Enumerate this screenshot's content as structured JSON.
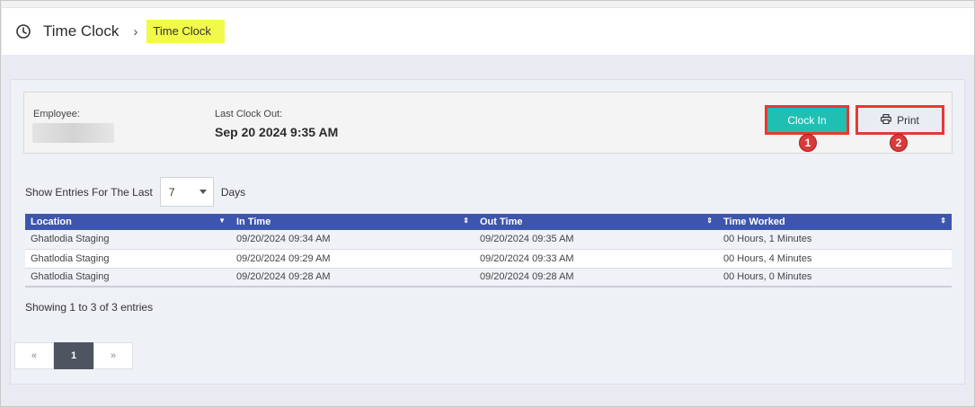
{
  "header": {
    "title": "Time Clock",
    "breadcrumb_current": "Time Clock"
  },
  "employee_panel": {
    "employee_label": "Employee:",
    "last_clock_out_label": "Last Clock Out:",
    "last_clock_out_value": "Sep 20 2024 9:35 AM",
    "clock_in_label": "Clock In",
    "print_label": "Print",
    "badge_1": "1",
    "badge_2": "2"
  },
  "filter": {
    "prefix": "Show Entries For The Last",
    "selected_days": "7",
    "suffix": "Days"
  },
  "table": {
    "columns": [
      "Location",
      "In Time",
      "Out Time",
      "Time Worked"
    ],
    "rows": [
      [
        "Ghatlodia Staging",
        "09/20/2024 09:34 AM",
        "09/20/2024 09:35 AM",
        "00 Hours, 1 Minutes"
      ],
      [
        "Ghatlodia Staging",
        "09/20/2024 09:29 AM",
        "09/20/2024 09:33 AM",
        "00 Hours, 4 Minutes"
      ],
      [
        "Ghatlodia Staging",
        "09/20/2024 09:28 AM",
        "09/20/2024 09:28 AM",
        "00 Hours, 0 Minutes"
      ]
    ]
  },
  "footer": {
    "showing_text": "Showing 1 to 3 of 3 entries"
  },
  "pagination": {
    "prev": "«",
    "current": "1",
    "next": "»"
  },
  "colors": {
    "accent_teal": "#1fbfb3",
    "table_header": "#3d55ad",
    "highlight_red": "#e53935",
    "breadcrumb_highlight": "#f1f94a"
  }
}
